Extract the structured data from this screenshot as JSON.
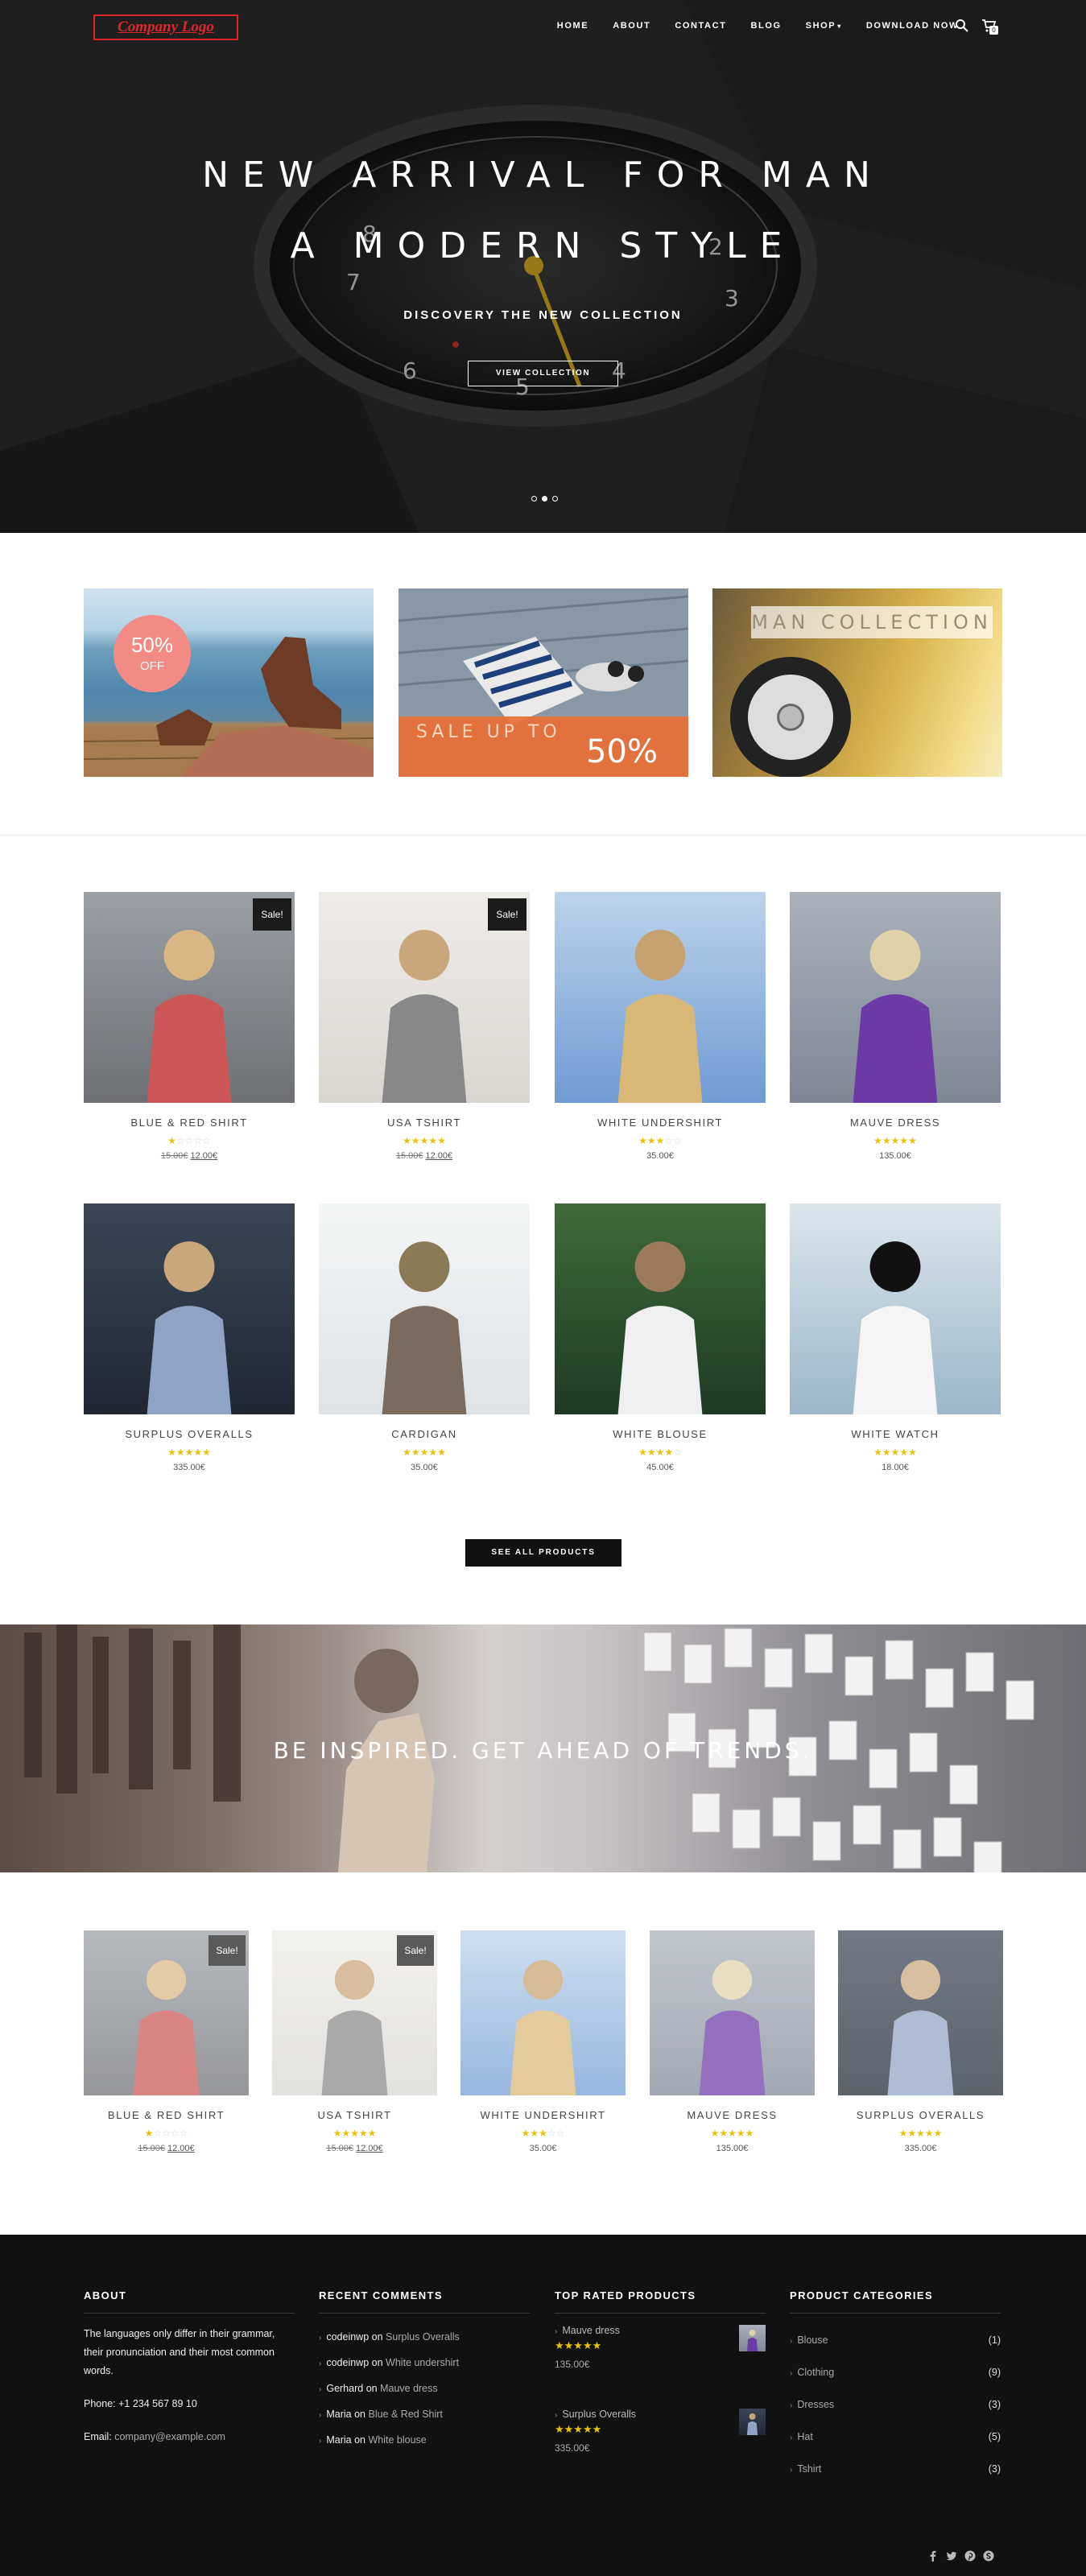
{
  "nav": {
    "logo": "Company Logo",
    "items": [
      {
        "label": "HOME"
      },
      {
        "label": "ABOUT"
      },
      {
        "label": "CONTACT"
      },
      {
        "label": "BLOG"
      },
      {
        "label": "SHOP"
      },
      {
        "label": "DOWNLOAD NOW"
      }
    ],
    "cart_count": "0"
  },
  "hero": {
    "title_line1": "NEW ARRIVAL FOR MAN",
    "title_line2": "A MODERN STYLE",
    "subtitle": "DISCOVERY THE NEW COLLECTION",
    "button": "VIEW COLLECTION",
    "slides": 3,
    "active_slide": 2
  },
  "promos": {
    "p1": {
      "big": "50%",
      "small": "OFF"
    },
    "p2": {
      "text": "SALE UP TO",
      "num": "50%"
    },
    "p3": {
      "label": "MAN COLLECTION"
    }
  },
  "products": [
    {
      "name": "BLUE & RED SHIRT",
      "rating": 1,
      "old_price": "15.00€",
      "price": "12.00€",
      "sale": "Sale!"
    },
    {
      "name": "USA TSHIRT",
      "rating": 5,
      "old_price": "15.00€",
      "price": "12.00€",
      "sale": "Sale!"
    },
    {
      "name": "WHITE UNDERSHIRT",
      "rating": 3,
      "price": "35.00€"
    },
    {
      "name": "MAUVE DRESS",
      "rating": 5,
      "price": "135.00€"
    },
    {
      "name": "SURPLUS OVERALLS",
      "rating": 5,
      "price": "335.00€"
    },
    {
      "name": "CARDIGAN",
      "rating": 5,
      "price": "35.00€"
    },
    {
      "name": "WHITE BLOUSE",
      "rating": 4,
      "price": "45.00€"
    },
    {
      "name": "WHITE WATCH",
      "rating": 5,
      "price": "18.00€"
    }
  ],
  "see_all": "SEE ALL PRODUCTS",
  "inspired": "BE INSPIRED. GET AHEAD OF TRENDS.",
  "featured": [
    {
      "name": "BLUE & RED SHIRT",
      "rating": 1,
      "old_price": "15.00€",
      "price": "12.00€",
      "sale": "Sale!"
    },
    {
      "name": "USA TSHIRT",
      "rating": 5,
      "old_price": "15.00€",
      "price": "12.00€",
      "sale": "Sale!"
    },
    {
      "name": "WHITE UNDERSHIRT",
      "rating": 3,
      "price": "35.00€"
    },
    {
      "name": "MAUVE DRESS",
      "rating": 5,
      "price": "135.00€"
    },
    {
      "name": "SURPLUS OVERALLS",
      "rating": 5,
      "price": "335.00€"
    }
  ],
  "footer": {
    "about": {
      "title": "ABOUT",
      "text": "The languages only differ in their grammar, their pronunciation and their most common words.",
      "phone_label": "Phone:",
      "phone": "+1 234 567 89 10",
      "email_label": "Email:",
      "email": "company@example.com"
    },
    "comments": {
      "title": "RECENT COMMENTS",
      "joiner": "on",
      "items": [
        {
          "author": "codeinwp",
          "post": "Surplus Overalls"
        },
        {
          "author": "codeinwp",
          "post": "White undershirt"
        },
        {
          "author": "Gerhard",
          "post": "Mauve dress"
        },
        {
          "author": "Maria",
          "post": "Blue & Red Shirt"
        },
        {
          "author": "Maria",
          "post": "White blouse"
        }
      ]
    },
    "top_rated": {
      "title": "TOP RATED PRODUCTS",
      "items": [
        {
          "name": "Mauve dress",
          "rating": 5,
          "price": "135.00€"
        },
        {
          "name": "Surplus Overalls",
          "rating": 5,
          "price": "335.00€"
        }
      ]
    },
    "categories": {
      "title": "PRODUCT CATEGORIES",
      "items": [
        {
          "name": "Blouse",
          "count": "(1)"
        },
        {
          "name": "Clothing",
          "count": "(9)"
        },
        {
          "name": "Dresses",
          "count": "(3)"
        },
        {
          "name": "Hat",
          "count": "(5)"
        },
        {
          "name": "Tshirt",
          "count": "(3)"
        }
      ]
    },
    "social": [
      "facebook-icon",
      "twitter-icon",
      "pinterest-icon",
      "skype-icon"
    ]
  },
  "colors": {
    "logo_red": "#e0262b",
    "star_yellow": "#e8c20f",
    "footer_bg": "#111111",
    "sale_orange": "#e86e34",
    "badge_pink": "#f28b84"
  }
}
